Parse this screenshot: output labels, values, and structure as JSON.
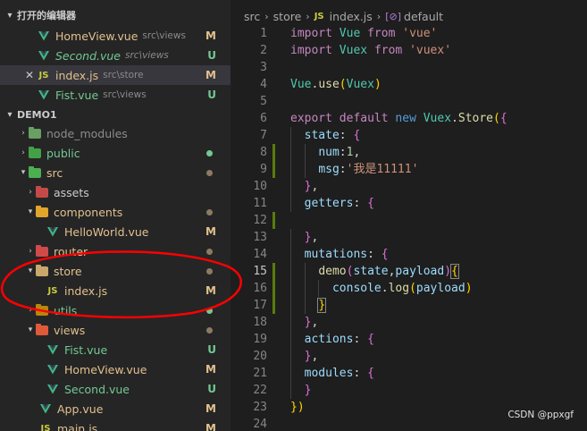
{
  "explorer": {
    "open_editors_header": "打开的编辑器",
    "open_editors": [
      {
        "name": "HomeView.vue",
        "path": "src\\views",
        "badge": "M",
        "type": "vue",
        "italic": false,
        "selected": false,
        "close": false
      },
      {
        "name": "Second.vue",
        "path": "src\\views",
        "badge": "U",
        "type": "vue",
        "italic": true,
        "selected": false,
        "close": false
      },
      {
        "name": "index.js",
        "path": "src\\store",
        "badge": "M",
        "type": "js",
        "italic": false,
        "selected": true,
        "close": true
      },
      {
        "name": "Fist.vue",
        "path": "src\\views",
        "badge": "U",
        "type": "vue",
        "italic": false,
        "selected": false,
        "close": false
      }
    ],
    "project_header": "DEMO1",
    "tree": [
      {
        "name": "node_modules",
        "kind": "folder",
        "icon": "node-folder-icon",
        "depth": 1,
        "expanded": false,
        "status": "none",
        "color": "#8c8c8c"
      },
      {
        "name": "public",
        "kind": "folder",
        "icon": "public-folder-icon",
        "depth": 1,
        "expanded": false,
        "status": "dot-green",
        "color": "#73c991"
      },
      {
        "name": "src",
        "kind": "folder",
        "icon": "src-folder-icon",
        "depth": 1,
        "expanded": true,
        "status": "dot-gray",
        "color": "#e2c08d"
      },
      {
        "name": "assets",
        "kind": "folder",
        "icon": "assets-folder-icon",
        "depth": 2,
        "expanded": false,
        "status": "none",
        "color": "#cccccc"
      },
      {
        "name": "components",
        "kind": "folder",
        "icon": "components-folder-icon",
        "depth": 2,
        "expanded": true,
        "status": "dot-gray",
        "color": "#e2c08d"
      },
      {
        "name": "HelloWorld.vue",
        "kind": "vue",
        "icon": "vue-file-icon",
        "depth": 3,
        "expanded": false,
        "status": "M",
        "color": "#e2c08d"
      },
      {
        "name": "router",
        "kind": "folder",
        "icon": "router-folder-icon",
        "depth": 2,
        "expanded": false,
        "status": "dot-gray",
        "color": "#e2c08d"
      },
      {
        "name": "store",
        "kind": "folder",
        "icon": "store-folder-icon",
        "depth": 2,
        "expanded": true,
        "status": "dot-gray",
        "color": "#e2c08d"
      },
      {
        "name": "index.js",
        "kind": "js",
        "icon": "js-file-icon",
        "depth": 3,
        "expanded": false,
        "status": "M",
        "color": "#e2c08d"
      },
      {
        "name": "utils",
        "kind": "folder",
        "icon": "utils-folder-icon",
        "depth": 2,
        "expanded": false,
        "status": "dot-green",
        "color": "#73c991"
      },
      {
        "name": "views",
        "kind": "folder",
        "icon": "views-folder-icon",
        "depth": 2,
        "expanded": true,
        "status": "dot-gray",
        "color": "#e2c08d"
      },
      {
        "name": "Fist.vue",
        "kind": "vue",
        "icon": "vue-file-icon",
        "depth": 3,
        "expanded": false,
        "status": "U",
        "color": "#73c991"
      },
      {
        "name": "HomeView.vue",
        "kind": "vue",
        "icon": "vue-file-icon",
        "depth": 3,
        "expanded": false,
        "status": "M",
        "color": "#e2c08d"
      },
      {
        "name": "Second.vue",
        "kind": "vue",
        "icon": "vue-file-icon",
        "depth": 3,
        "expanded": false,
        "status": "U",
        "color": "#73c991"
      },
      {
        "name": "App.vue",
        "kind": "vue",
        "icon": "vue-file-icon",
        "depth": 2,
        "expanded": false,
        "status": "M",
        "color": "#e2c08d"
      },
      {
        "name": "main.js",
        "kind": "js",
        "icon": "js-file-icon",
        "depth": 2,
        "expanded": false,
        "status": "M",
        "color": "#e2c08d"
      }
    ]
  },
  "breadcrumb": {
    "part1": "src",
    "part2": "store",
    "part3": "index.js",
    "part4": "default",
    "js_badge": "JS"
  },
  "code": {
    "line_numbers": [
      "1",
      "2",
      "3",
      "4",
      "5",
      "6",
      "7",
      "8",
      "9",
      "10",
      "11",
      "12",
      "13",
      "14",
      "15",
      "16",
      "17",
      "18",
      "19",
      "20",
      "21",
      "22",
      "23",
      "24"
    ],
    "active_line": 15,
    "lines_text": [
      "import Vue from 'vue'",
      "import Vuex from 'vuex'",
      "",
      "Vue.use(Vuex)",
      "",
      "export default new Vuex.Store({",
      "  state: {",
      "    num:1,",
      "    msg:'我是11111'",
      "  },",
      "  getters: {",
      "",
      "  },",
      "  mutations: {",
      "    demo(state,payload){",
      "      console.log(payload)",
      "    }",
      "  },",
      "  actions: {",
      "  },",
      "  modules: {",
      "  }",
      "})",
      ""
    ]
  },
  "watermark": "CSDN @ppxgf",
  "colors": {
    "modified": "#e2c08d",
    "untracked": "#73c991",
    "annotation": "#ff0000",
    "vue": "#41b883",
    "js": "#cbcb41"
  }
}
